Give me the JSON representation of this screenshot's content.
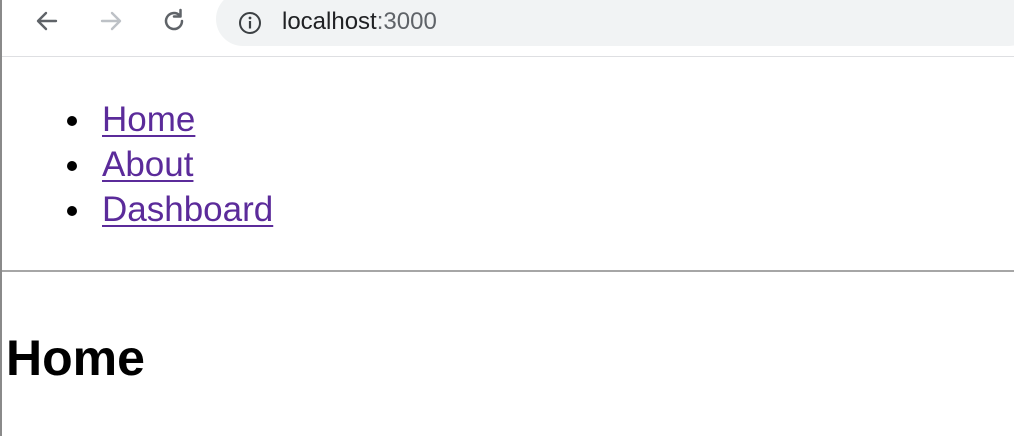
{
  "browser": {
    "back_icon": "arrow-left-icon",
    "forward_icon": "arrow-right-icon",
    "reload_icon": "reload-icon",
    "info_icon": "info-circle-icon",
    "url_host": "localhost",
    "url_port": ":3000"
  },
  "nav": {
    "items": [
      {
        "label": "Home"
      },
      {
        "label": "About"
      },
      {
        "label": "Dashboard"
      }
    ]
  },
  "main": {
    "heading": "Home"
  },
  "colors": {
    "link": "#5b2b9a",
    "omnibox_bg": "#f1f3f4",
    "divider": "#a6a6a6"
  }
}
